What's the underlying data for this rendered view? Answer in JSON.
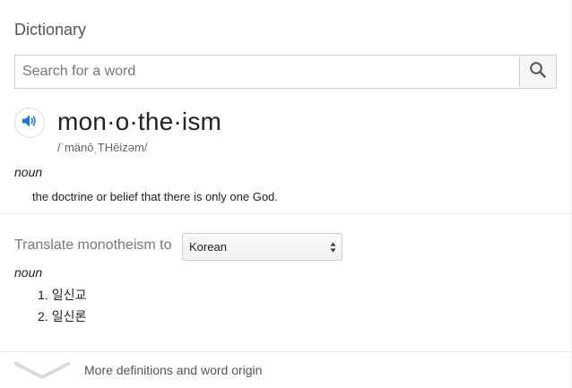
{
  "card": {
    "title": "Dictionary"
  },
  "search": {
    "placeholder": "Search for a word",
    "value": "",
    "button_icon": "search-icon"
  },
  "entry": {
    "speaker_icon": "speaker-icon",
    "headword": "mon·o·the·ism",
    "phonetic": "/ˈmänōˌTHēizəm/",
    "part_of_speech": "noun",
    "definition": "the doctrine or belief that there is only one God."
  },
  "translate": {
    "label": "Translate monotheism to",
    "selected_language": "Korean",
    "part_of_speech": "noun",
    "results": [
      {
        "num": "1.",
        "text": "일신교"
      },
      {
        "num": "2.",
        "text": "일신론"
      }
    ]
  },
  "footer": {
    "more_label": "More definitions and word origin",
    "chevron_icon": "chevron-down-icon"
  },
  "colors": {
    "accent": "#1a73e8",
    "muted_text": "#777777",
    "border": "#d2d2d2"
  }
}
